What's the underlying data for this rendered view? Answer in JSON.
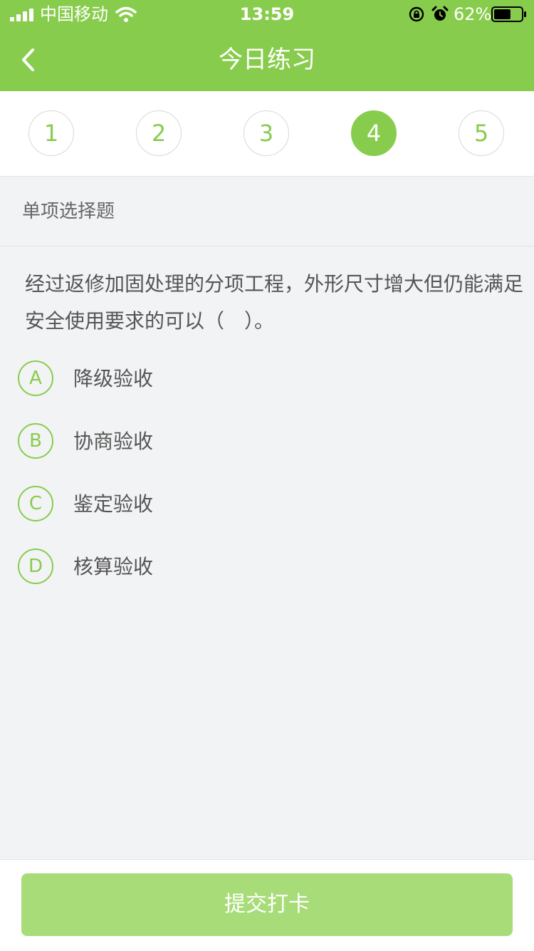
{
  "status_bar": {
    "carrier": "中国移动",
    "time": "13:59",
    "battery": "62%",
    "battery_level": 0.62,
    "icons": [
      "signal-icon",
      "wifi-icon",
      "orientation-lock-icon",
      "alarm-icon",
      "battery-icon"
    ]
  },
  "nav": {
    "back_icon": "chevron-left-icon",
    "title": "今日练习"
  },
  "question_nav": {
    "items": [
      "1",
      "2",
      "3",
      "4",
      "5"
    ],
    "active": "4"
  },
  "question": {
    "type": "单项选择题",
    "text": "经过返修加固处理的分项工程，外形尺寸增大但仍能满足安全使用要求的可以（　）。",
    "options": [
      {
        "letter": "A",
        "text": "降级验收"
      },
      {
        "letter": "B",
        "text": "协商验收"
      },
      {
        "letter": "C",
        "text": "鉴定验收"
      },
      {
        "letter": "D",
        "text": "核算验收"
      }
    ]
  },
  "footer": {
    "submit_label": "提交打卡"
  },
  "colors": {
    "brand_green": "#88cc4d",
    "button_green": "#a8dc78",
    "background": "#f2f3f5"
  }
}
